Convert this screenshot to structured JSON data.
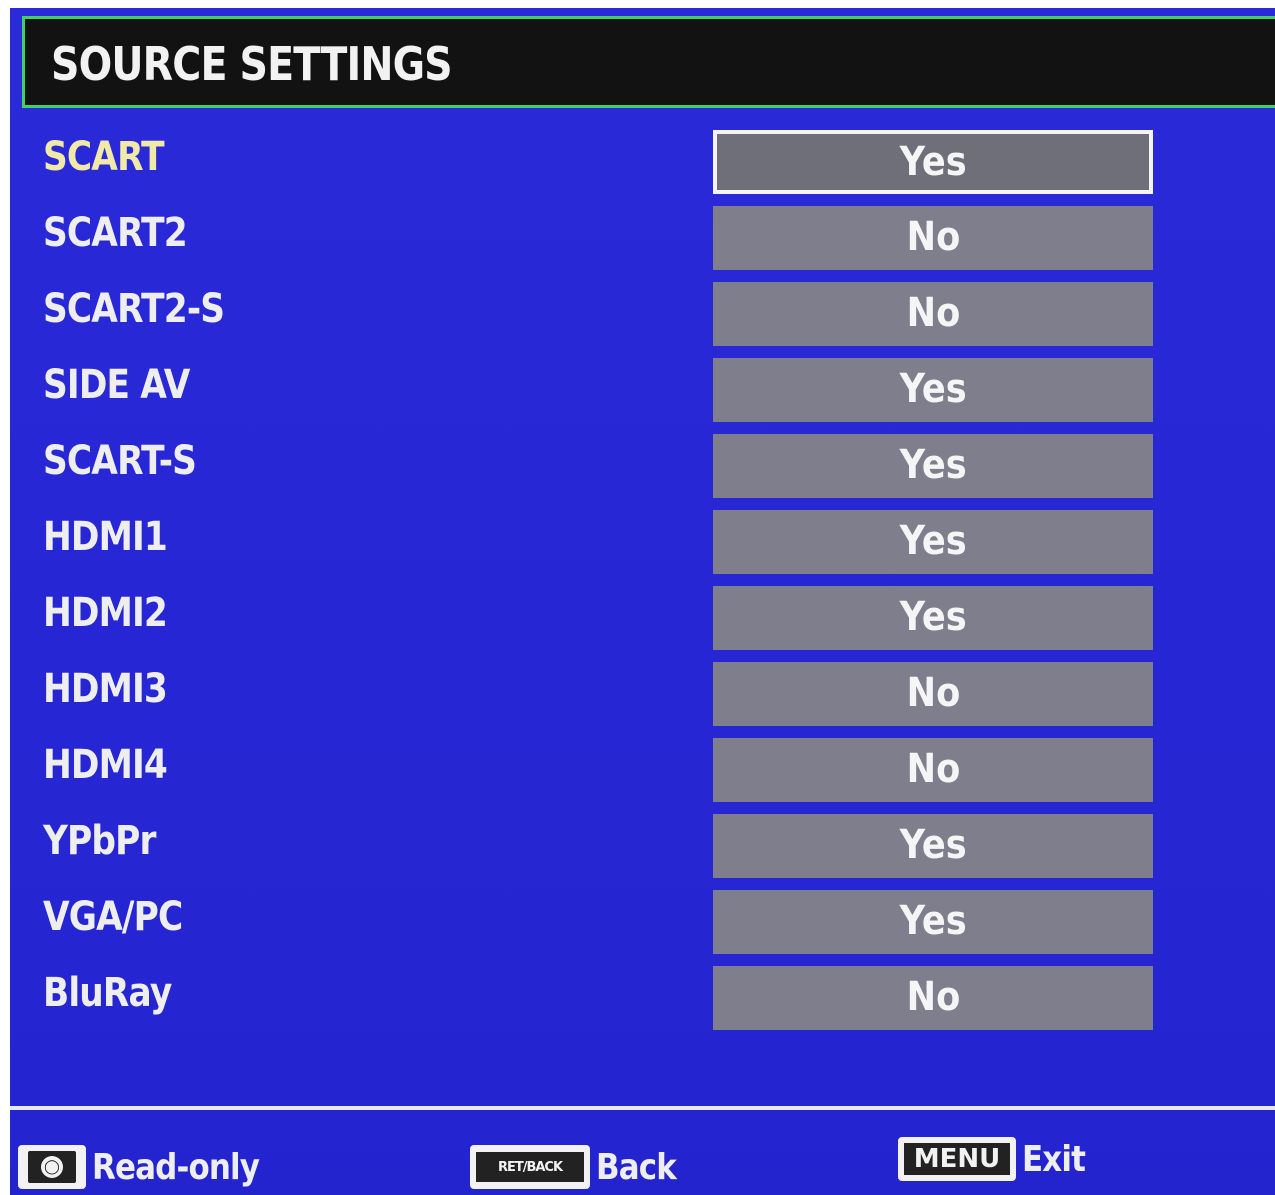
{
  "header": {
    "title": "SOURCE SETTINGS"
  },
  "sources": [
    {
      "label": "SCART",
      "value": "Yes",
      "selected": true
    },
    {
      "label": "SCART2",
      "value": "No",
      "selected": false
    },
    {
      "label": "SCART2-S",
      "value": "No",
      "selected": false
    },
    {
      "label": "SIDE AV",
      "value": "Yes",
      "selected": false
    },
    {
      "label": "SCART-S",
      "value": "Yes",
      "selected": false
    },
    {
      "label": "HDMI1",
      "value": "Yes",
      "selected": false
    },
    {
      "label": "HDMI2",
      "value": "Yes",
      "selected": false
    },
    {
      "label": "HDMI3",
      "value": "No",
      "selected": false
    },
    {
      "label": "HDMI4",
      "value": "No",
      "selected": false
    },
    {
      "label": "YPbPr",
      "value": "Yes",
      "selected": false
    },
    {
      "label": "VGA/PC",
      "value": "Yes",
      "selected": false
    },
    {
      "label": "BluRay",
      "value": "No",
      "selected": false
    }
  ],
  "footer": {
    "readonly_label": "Read-only",
    "back_key": "RET/BACK",
    "back_label": "Back",
    "menu_key": "MENU",
    "exit_label": "Exit"
  },
  "colors": {
    "background": "#2727d6",
    "title_bar": "#121212",
    "title_border": "#3fd066",
    "selected_label": "#f1e9a8",
    "value_box": "#7e7e8c"
  }
}
